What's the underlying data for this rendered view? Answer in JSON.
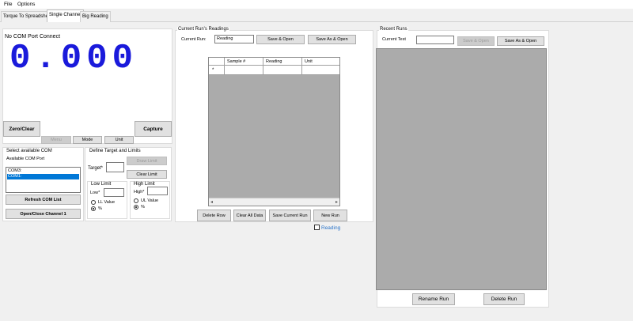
{
  "menu": {
    "file": "File",
    "options": "Options"
  },
  "tabs": [
    "Torque To Spreadsheet",
    "Single Channel",
    "Big Reading"
  ],
  "channel": {
    "status": "No COM Port Connect",
    "reading": "0.000",
    "zero_clear": "Zero/Clear",
    "capture": "Capture",
    "menu_btn": "Menu",
    "mode_btn": "Mode",
    "unit_btn": "Unit"
  },
  "com": {
    "title": "Select available COM",
    "label": "Available COM Port",
    "ports": [
      "COM3:",
      "COM1:"
    ],
    "selected_index": 1,
    "refresh": "Refresh COM List",
    "open_close": "Open/Close Channel 1"
  },
  "limits": {
    "title": "Define Target and Limits",
    "target_label": "Target*",
    "target_value": "",
    "draw_limit": "Draw Limit",
    "clear_limit": "Clear Limit",
    "low": {
      "title": "Low Limit",
      "label": "Low*",
      "value": "",
      "opt1": "LL Value",
      "opt2": "%",
      "selected": "%"
    },
    "high": {
      "title": "High Limit",
      "label": "High*",
      "value": "",
      "opt1": "UL Value",
      "opt2": "%",
      "selected": "%"
    }
  },
  "current_run": {
    "title": "Current Run's Readings",
    "run_label": "Current Run:",
    "run_value": "Reading",
    "save_open": "Save & Open",
    "save_as_open": "Save As & Open",
    "columns": [
      "Sample #",
      "Reading",
      "Unit"
    ],
    "new_row_marker": "*",
    "delete_row": "Delete Row",
    "clear_all": "Clear All Data",
    "save_current": "Save Current Run",
    "new_run": "New Run",
    "reading_checkbox": "Reading",
    "reading_checked": false
  },
  "recent_runs": {
    "title": "Recent Runs",
    "test_label": "Current Test",
    "test_value": "",
    "save_open": "Save & Open",
    "save_as_open": "Save As & Open",
    "rename": "Rename Run",
    "delete": "Delete Run"
  },
  "colors": {
    "reading": "#1a1adb",
    "link": "#2a73c8",
    "selection": "#0078d7",
    "panel_gray": "#ababab"
  }
}
